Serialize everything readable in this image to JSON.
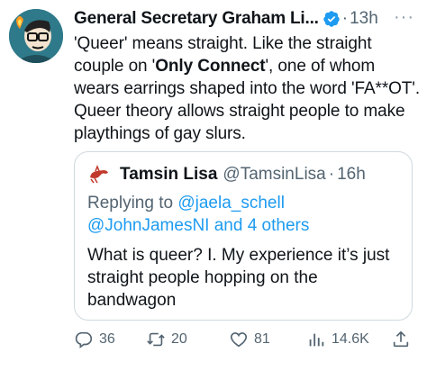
{
  "tweet": {
    "author_name": "General Secretary Graham Li...",
    "time": "13h",
    "text": {
      "p1": "'Queer' means straight. Like the straight couple on '",
      "bold": "Only Connect",
      "p2": "', one of whom wears earrings shaped into the word 'FA**OT'. Queer theory allows straight people to make playthings of gay slurs."
    },
    "more_label": "···"
  },
  "quote": {
    "author_name": "Tamsin Lisa",
    "handle": "@TamsinLisa",
    "time": "16h",
    "replying_prefix": "Replying to",
    "reply_to": "@jaela_schell",
    "reply_to_2": "@JohnJamesNI",
    "reply_suffix": "and 4 others",
    "text": "What is queer? I. My experience it’s just straight people hopping on the bandwagon"
  },
  "actions": {
    "replies": "36",
    "retweets": "20",
    "likes": "81",
    "views": "14.6K"
  },
  "colors": {
    "link": "#1d9bf0",
    "secondary_text": "#536471",
    "border": "#cfd9de",
    "verified": "#1d9bf0"
  },
  "icons": [
    "avatar",
    "verified-badge-icon",
    "more-icon",
    "reply-icon",
    "retweet-icon",
    "like-icon",
    "views-icon",
    "share-icon"
  ]
}
